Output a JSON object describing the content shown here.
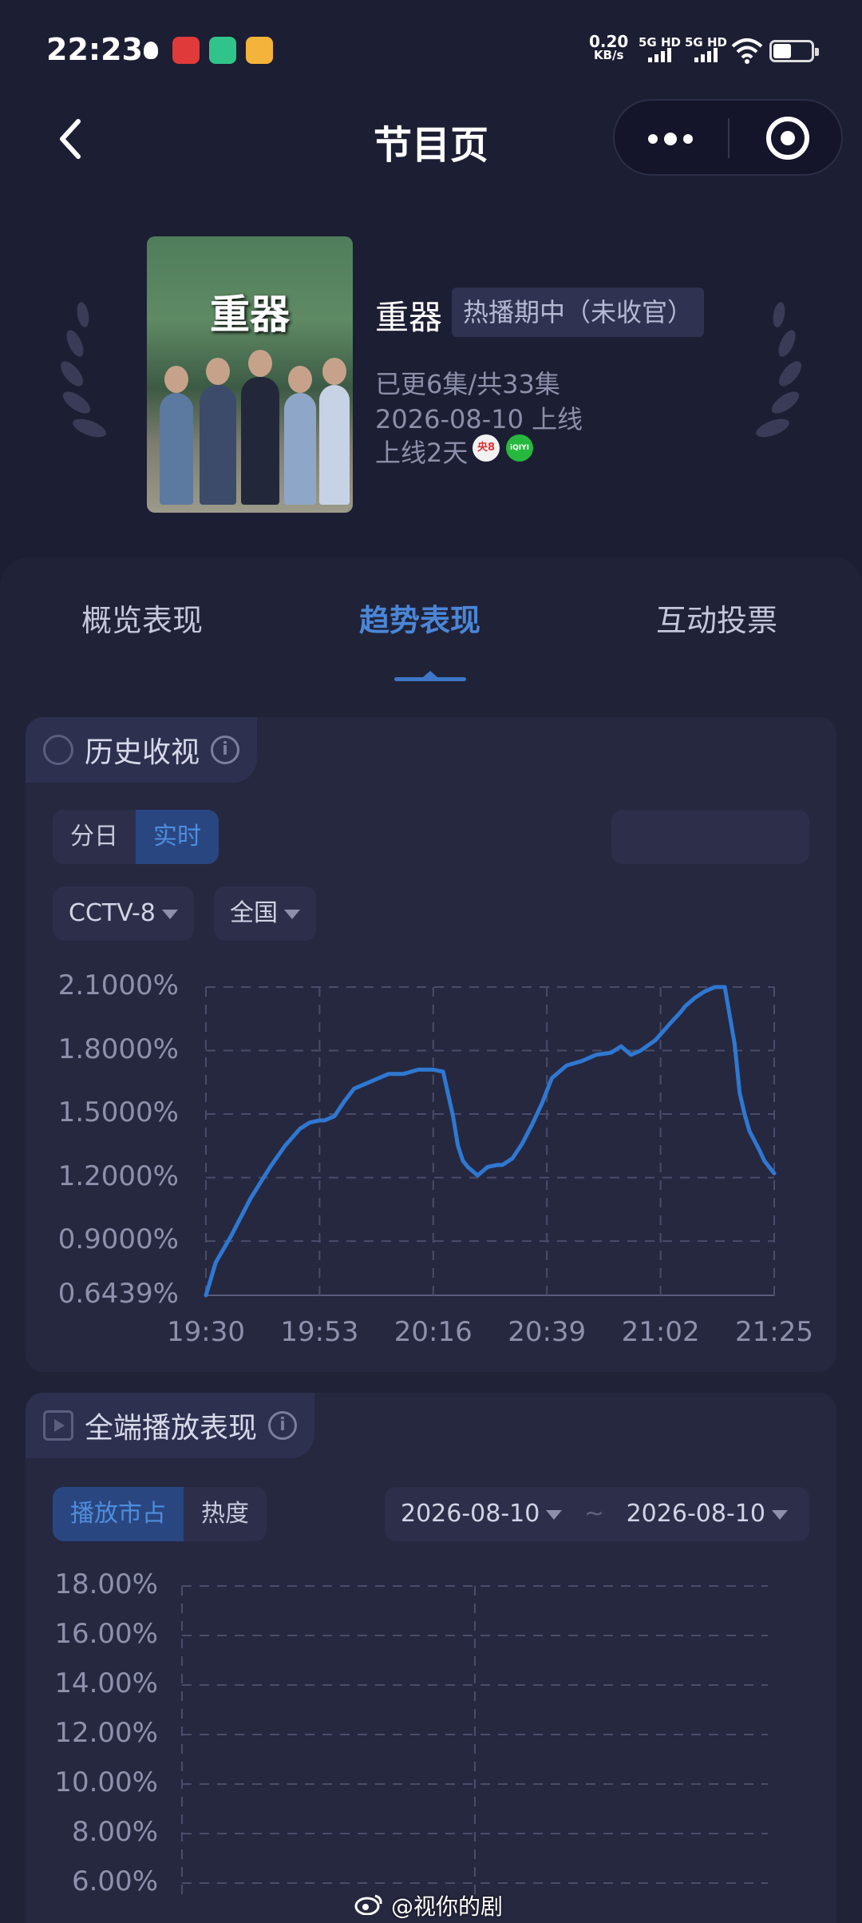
{
  "status_bar": {
    "time": "22:23",
    "net_speed": "0.20",
    "net_unit": "KB/s",
    "sim1": "5G HD",
    "sim2": "5G HD"
  },
  "nav": {
    "title": "节目页"
  },
  "show": {
    "poster_title": "重器",
    "name": "重器",
    "status": "热播期中（未收官）",
    "episodes": "已更6集/共33集",
    "premiere": "2026-08-10 上线",
    "days_online": "上线2天",
    "channel_badges": [
      "央8",
      "iQIYI"
    ]
  },
  "tabs": [
    {
      "label": "概览表现",
      "active": false
    },
    {
      "label": "趋势表现",
      "active": true
    },
    {
      "label": "互动投票",
      "active": false
    }
  ],
  "history": {
    "title": "历史收视",
    "seg": [
      "分日",
      "实时"
    ],
    "seg_active": 1,
    "channel_filter": "CCTV-8",
    "region_filter": "全国",
    "chart_data": {
      "type": "line",
      "title": "",
      "y_ticks": [
        "2.1000%",
        "1.8000%",
        "1.5000%",
        "1.2000%",
        "0.9000%",
        "0.6439%"
      ],
      "x_ticks": [
        "19:30",
        "19:53",
        "20:16",
        "20:39",
        "21:02",
        "21:25"
      ],
      "ylim": [
        0.6439,
        2.1
      ],
      "xlim_minutes": [
        0,
        115
      ],
      "series": [
        {
          "color": "#2f78d2",
          "x": [
            0,
            2,
            5,
            9,
            13,
            16,
            19,
            21,
            23,
            24,
            26,
            28,
            30,
            32,
            34,
            37,
            40,
            43,
            46,
            48,
            50,
            51,
            52,
            53,
            55,
            57,
            59,
            60,
            62,
            64,
            66,
            68,
            70,
            73,
            76,
            79,
            82,
            84,
            86,
            88,
            91,
            94,
            96,
            97,
            99,
            101,
            103,
            105,
            107,
            108,
            109,
            110,
            112,
            113,
            115
          ],
          "y": [
            0.6439,
            0.8,
            0.92,
            1.1,
            1.25,
            1.35,
            1.43,
            1.46,
            1.47,
            1.47,
            1.49,
            1.56,
            1.62,
            1.64,
            1.66,
            1.69,
            1.69,
            1.71,
            1.71,
            1.7,
            1.49,
            1.35,
            1.28,
            1.25,
            1.21,
            1.25,
            1.26,
            1.26,
            1.29,
            1.36,
            1.45,
            1.55,
            1.67,
            1.73,
            1.75,
            1.78,
            1.79,
            1.82,
            1.78,
            1.8,
            1.85,
            1.93,
            1.98,
            2.01,
            2.05,
            2.08,
            2.1,
            2.1,
            1.83,
            1.6,
            1.5,
            1.42,
            1.33,
            1.28,
            1.22
          ]
        }
      ]
    }
  },
  "playback": {
    "title": "全端播放表现",
    "seg": [
      "播放市占",
      "热度"
    ],
    "seg_active": 0,
    "date_from": "2026-08-10",
    "date_sep": "~",
    "date_to": "2026-08-10",
    "chart_data": {
      "type": "line",
      "y_ticks": [
        "18.00%",
        "16.00%",
        "14.00%",
        "12.00%",
        "10.00%",
        "8.00%",
        "6.00%"
      ],
      "series": []
    }
  },
  "watermark": "@视你的剧",
  "colors": {
    "background": "#1c1e33",
    "accent": "#3f77c8",
    "line": "#2f78d2",
    "card": "#262840"
  }
}
